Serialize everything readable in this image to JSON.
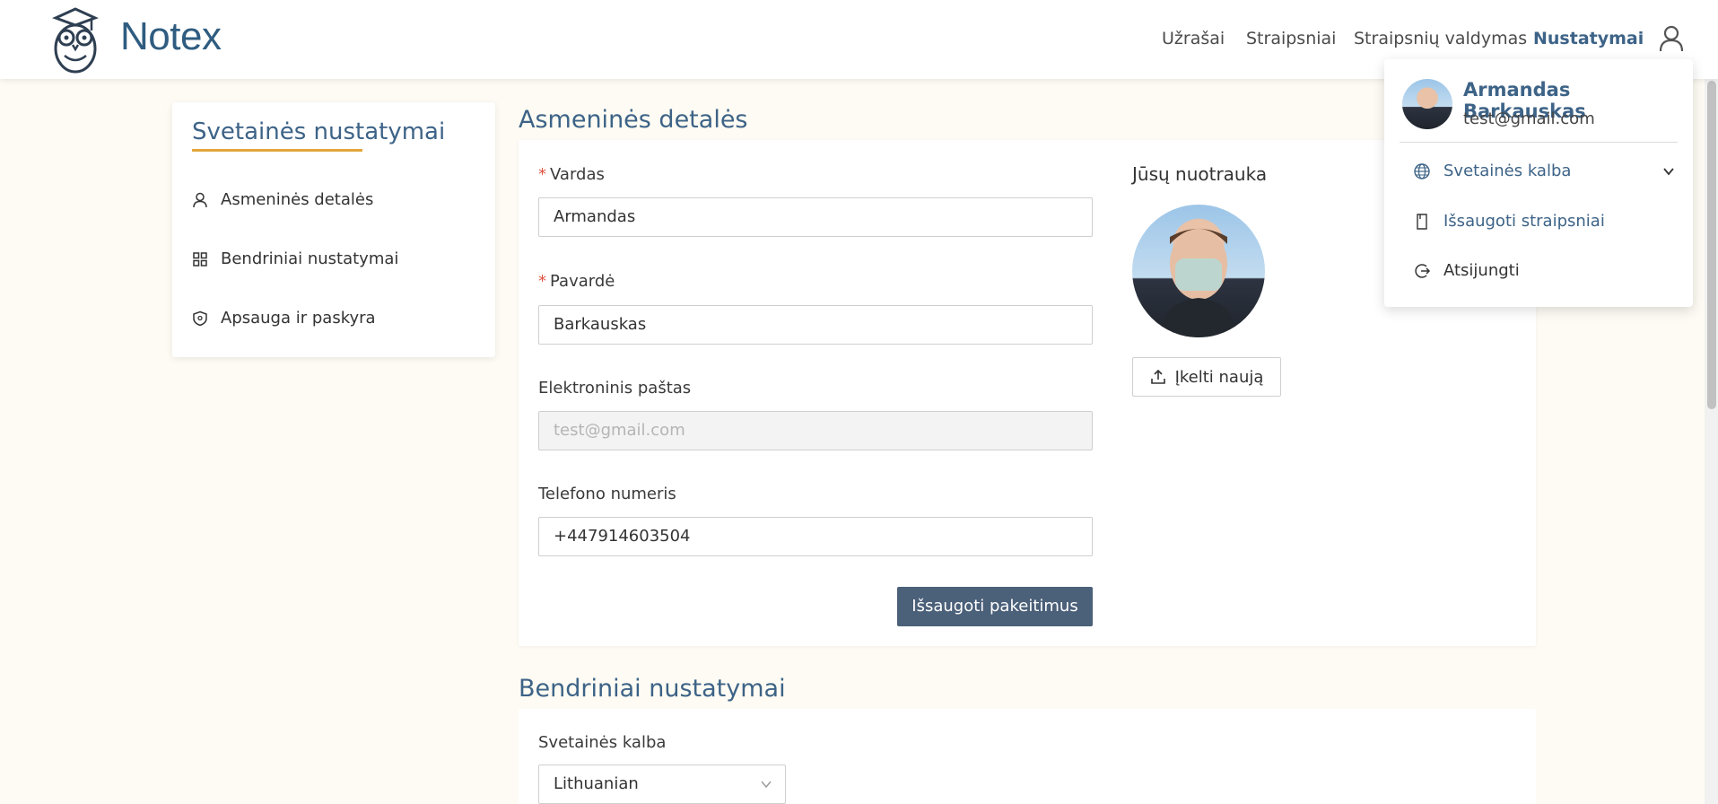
{
  "header": {
    "brand": "Notex",
    "nav": [
      "Užrašai",
      "Straipsniai",
      "Straipsnių valdymas",
      "Nustatymai"
    ]
  },
  "sidebar": {
    "title": "Svetainės nustatymai",
    "items": [
      {
        "label": "Asmeninės detalės",
        "icon": "user-icon"
      },
      {
        "label": "Bendriniai nustatymai",
        "icon": "grid-icon"
      },
      {
        "label": "Apsauga ir paskyra",
        "icon": "shield-icon"
      }
    ]
  },
  "personal": {
    "heading": "Asmeninės detalės",
    "first_name_label": "Vardas",
    "first_name_value": "Armandas",
    "last_name_label": "Pavardė",
    "last_name_value": "Barkauskas",
    "email_label": "Elektroninis paštas",
    "email_value": "test@gmail.com",
    "phone_label": "Telefono numeris",
    "phone_value": "+447914603504",
    "save_label": "Išsaugoti pakeitimus",
    "photo_label": "Jūsų nuotrauka",
    "upload_label": "Įkelti naują"
  },
  "general": {
    "heading": "Bendriniai nustatymai",
    "language_label": "Svetainės kalba",
    "language_value": "Lithuanian"
  },
  "dropdown": {
    "name": "Armandas Barkauskas",
    "email": "test@gmail.com",
    "items": [
      {
        "label": "Svetainės kalba",
        "icon": "globe-icon"
      },
      {
        "label": "Išsaugoti straipsniai",
        "icon": "bookmark-icon"
      },
      {
        "label": "Atsijungti",
        "icon": "logout-icon"
      }
    ]
  },
  "colors": {
    "accent": "#3d6387",
    "underline": "#e3a63a",
    "button": "#4b6079",
    "background": "#fdfbf3",
    "required": "#e0533f"
  }
}
